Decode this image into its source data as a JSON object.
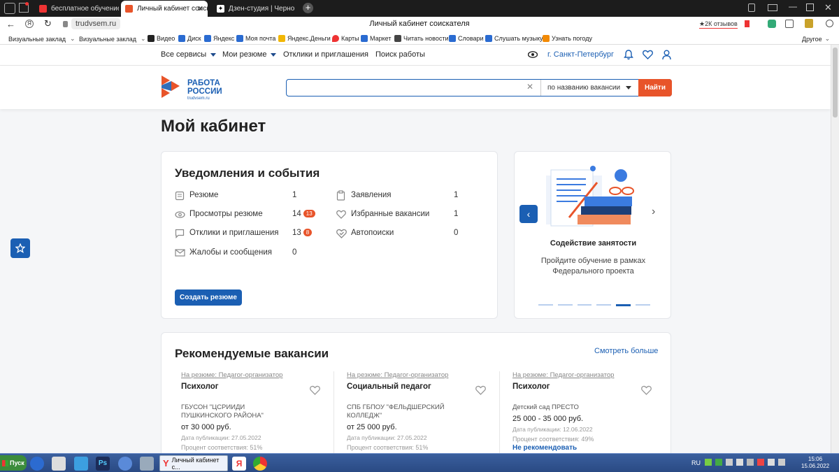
{
  "browser": {
    "tabs": [
      {
        "label": "бесплатное обучение для",
        "active": false
      },
      {
        "label": "Личный кабинет соиск",
        "active": true
      },
      {
        "label": "Дзен-студия | Черновик",
        "active": false
      }
    ],
    "page_title": "Личный кабинет соискателя",
    "url": "trudvsem.ru",
    "reviews": "★2К отзывов",
    "bookmarks": [
      "Визуальные заклад",
      "Визуальные заклад",
      "Видео",
      "Диск",
      "Яндекс",
      "Моя почта",
      "Яндекс.Деньги",
      "Карты",
      "Маркет",
      "Читать новости",
      "Словари",
      "Слушать музыку",
      "Узнать погоду"
    ],
    "bookmarks_other": "Другое"
  },
  "nav": {
    "all_services": "Все сервисы",
    "my_resume": "Мои резюме",
    "responses": "Отклики и приглашения",
    "job_search": "Поиск работы",
    "city": "г. Санкт-Петербург"
  },
  "header": {
    "logo_line1": "РАБОТА",
    "logo_line2": "РОССИИ",
    "logo_sub": "trudvsem.ru",
    "search_value": "",
    "search_mode": "по названию вакансии",
    "search_button": "Найти"
  },
  "page": {
    "title": "Мой кабинет"
  },
  "notifications": {
    "title": "Уведомления и события",
    "left": [
      {
        "label": "Резюме",
        "count": "1",
        "badge": "",
        "icon": "resume-icon"
      },
      {
        "label": "Просмотры резюме",
        "count": "14",
        "badge": "13",
        "icon": "eye-icon"
      },
      {
        "label": "Отклики и приглашения",
        "count": "13",
        "badge": "8",
        "icon": "chat-icon"
      },
      {
        "label": "Жалобы и сообщения",
        "count": "0",
        "badge": "",
        "icon": "mail-icon"
      }
    ],
    "right": [
      {
        "label": "Заявления",
        "count": "1",
        "icon": "clipboard-icon"
      },
      {
        "label": "Избранные вакансии",
        "count": "1",
        "icon": "heart-icon"
      },
      {
        "label": "Автопоиски",
        "count": "0",
        "icon": "autosearch-icon"
      }
    ],
    "create_button": "Создать резюме"
  },
  "promo": {
    "title": "Содействие занятости",
    "text": "Пройдите обучение в рамках Федерального проекта",
    "dots": 6,
    "active_dot": 5
  },
  "recommended": {
    "title": "Рекомендуемые вакансии",
    "more": "Смотреть больше",
    "vacancies": [
      {
        "resume": "На резюме: Педагог-организатор",
        "title": "Психолог",
        "org": "ГБУСОН \"ЦСРИИДИ ПУШКИНСКОГО РАЙОНА\"",
        "salary": "от 30 000 руб.",
        "published": "Дата публикации: 27.05.2022",
        "match": "Процент соответствия: 51%"
      },
      {
        "resume": "На резюме: Педагог-организатор",
        "title": "Социальный педагог",
        "org": "СПБ ГБПОУ \"ФЕЛЬДШЕРСКИЙ КОЛЛЕДЖ\"",
        "salary": "от 25 000 руб.",
        "published": "Дата публикации: 27.05.2022",
        "match": "Процент соответствия: 51%"
      },
      {
        "resume": "На резюме: Педагог-организатор",
        "title": "Психолог",
        "org": "Детский сад ПРЕСТО",
        "salary": "25 000 - 35 000 руб.",
        "published": "Дата публикации: 12.06.2022",
        "match": "Процент соответствия: 49%",
        "extra": "Не рекомендовать"
      }
    ]
  },
  "taskbar": {
    "start": "Пуск",
    "active_window": "Личный кабинет с...",
    "lang": "RU",
    "time": "15:06",
    "date": "15.06.2022"
  },
  "colors": {
    "accent": "#1b5fb3",
    "brand_red": "#e8542a",
    "badge": "#e8542a"
  }
}
